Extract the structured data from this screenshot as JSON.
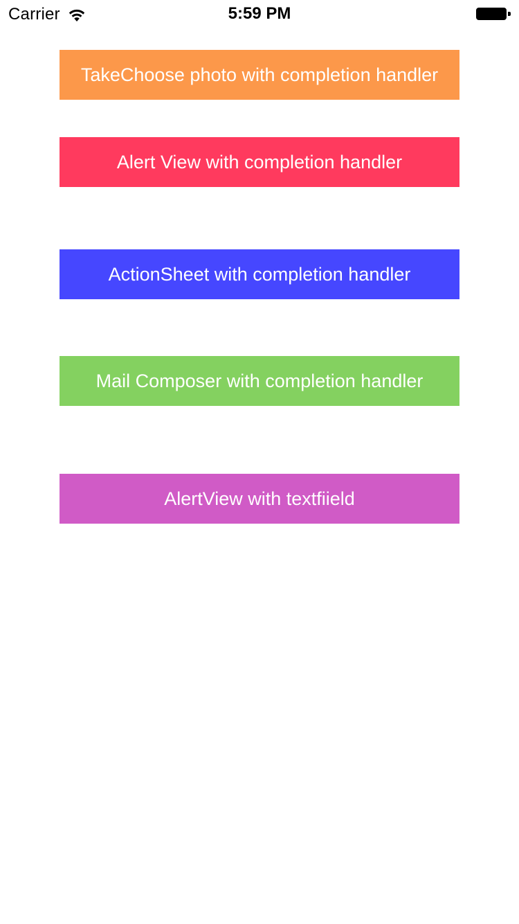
{
  "status_bar": {
    "carrier": "Carrier",
    "time": "5:59 PM",
    "wifi_icon": "wifi-icon",
    "battery_icon": "battery-icon",
    "battery_level": 1.0
  },
  "buttons": [
    {
      "label": "TakeChoose photo with completion handler",
      "color": "#FC984A"
    },
    {
      "label": "Alert View with completion handler",
      "color": "#FF3A5E"
    },
    {
      "label": "ActionSheet with completion handler",
      "color": "#4647FF"
    },
    {
      "label": "Mail Composer with completion handler",
      "color": "#84D160"
    },
    {
      "label": "AlertView with textfiield",
      "color": "#D05BC6"
    }
  ]
}
